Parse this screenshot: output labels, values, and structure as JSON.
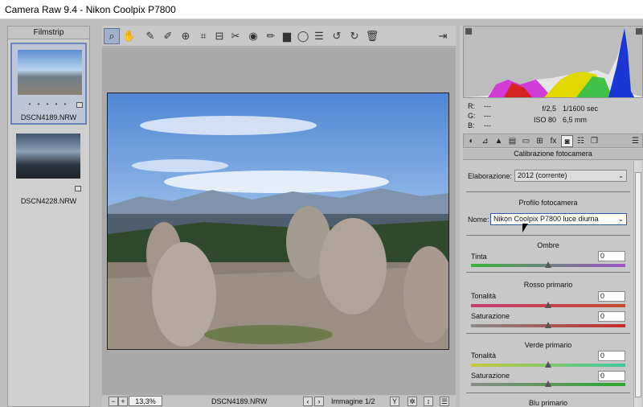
{
  "app": {
    "title": "Camera Raw 9.4  -  Nikon Coolpix P7800"
  },
  "filmstrip": {
    "label": "Filmstrip",
    "items": [
      {
        "name": "DSCN4189.NRW",
        "stars": "• • • • •"
      },
      {
        "name": "DSCN4228.NRW"
      }
    ]
  },
  "toolbar": {
    "icons": [
      "zoom-icon",
      "hand-icon",
      "white-balance-icon",
      "color-sampler-icon",
      "target-adjustment-icon",
      "crop-icon",
      "straighten-icon",
      "spot-removal-icon",
      "red-eye-icon",
      "adjustment-brush-icon",
      "graduated-filter-icon",
      "radial-filter-icon",
      "list-icon",
      "rotate-ccw-icon",
      "rotate-cw-icon",
      "trash-icon",
      "open-preferences-icon"
    ]
  },
  "status": {
    "zoom": "13,3%",
    "filename": "DSCN4189.NRW",
    "image": "Immagine 1/2"
  },
  "info": {
    "r": "R:",
    "g": "G:",
    "b": "B:",
    "rv": "---",
    "gv": "---",
    "bv": "---",
    "aperture": "f/2,5",
    "shutter": "1/1600 sec",
    "iso": "ISO 80",
    "focal": "6,5 mm"
  },
  "panel": {
    "title": "Calibrazione fotocamera",
    "process_label": "Elaborazione:",
    "process_value": "2012 (corrente)",
    "profile_section": "Profilo fotocamera",
    "name_label": "Nome:",
    "name_value": "Nikon Coolpix P7800 luce diurna",
    "shadows": "Ombre",
    "tint": "Tinta",
    "tint_value": "0",
    "red": "Rosso primario",
    "hue": "Tonalità",
    "red_hue": "0",
    "saturation": "Saturazione",
    "red_sat": "0",
    "green": "Verde primario",
    "green_hue": "0",
    "green_sat": "0",
    "blue": "Blu primario"
  },
  "colors": {
    "accent": "#6a86b6",
    "focus": "#2e5ca8"
  }
}
